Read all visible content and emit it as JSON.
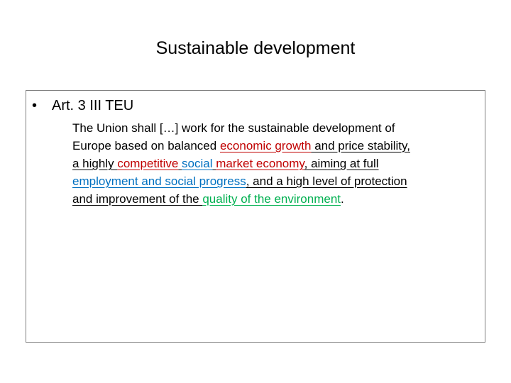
{
  "slide": {
    "title": "Sustainable development",
    "bullet_marker": "•",
    "bullet_text": "Art. 3 III TEU"
  },
  "colors": {
    "red": "#c00000",
    "blue": "#0070c0",
    "green": "#00b050"
  },
  "quote": {
    "lines": [
      [
        {
          "text": "The Union shall […] work for the sustainable development of",
          "color": "black",
          "underline": false
        }
      ],
      [
        {
          "text": "Europe based on balanced ",
          "color": "black",
          "underline": false
        },
        {
          "text": "economic growth",
          "color": "red",
          "underline": true
        },
        {
          "text": " and price stability,",
          "color": "black",
          "underline": true
        }
      ],
      [
        {
          "text": "a highly ",
          "color": "black",
          "underline": true
        },
        {
          "text": "competitive",
          "color": "red",
          "underline": true
        },
        {
          "text": " ",
          "color": "black",
          "underline": true
        },
        {
          "text": "social",
          "color": "blue",
          "underline": true
        },
        {
          "text": " ",
          "color": "black",
          "underline": true
        },
        {
          "text": "market economy",
          "color": "red",
          "underline": true
        },
        {
          "text": ", aiming at full",
          "color": "black",
          "underline": true
        }
      ],
      [
        {
          "text": "employment and social progress",
          "color": "blue",
          "underline": true
        },
        {
          "text": ", and a high level of protection",
          "color": "black",
          "underline": true
        }
      ],
      [
        {
          "text": "and improvement of the ",
          "color": "black",
          "underline": true
        },
        {
          "text": "quality of the environment",
          "color": "green",
          "underline": true
        },
        {
          "text": ".",
          "color": "black",
          "underline": false
        }
      ]
    ]
  }
}
